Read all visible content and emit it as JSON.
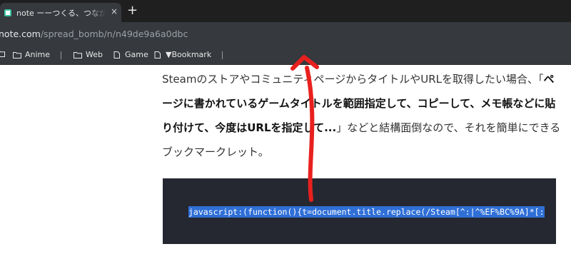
{
  "browser": {
    "tab": {
      "title": "note ーーつくる、つながる、と"
    },
    "new_tab_label": "+",
    "close_label": "×",
    "url": {
      "host": "note.com",
      "path": "/spread_bomb/n/n49de9a6a0dbc"
    },
    "bookmarks": [
      {
        "label": "Anime",
        "icon": "folder-icon"
      },
      {
        "label": "Web",
        "icon": "folder-icon"
      },
      {
        "label": "Game",
        "icon": "file-icon"
      },
      {
        "label": "▼Bookmark",
        "icon": "file-icon"
      }
    ]
  },
  "article": {
    "p1": "Steamのストアやコミュニティページからタイトルや",
    "p2": "URLを取得したい場合、「",
    "bold": "ページに書かれているゲームタイトルを範囲指定して、コピーして、メモ帳などに貼り付けて、今度はURLを指定して...",
    "p3": "」などと結構面倒なので、それを簡単にできるブックマークレット。"
  },
  "code": {
    "text": "javascript:(function(){t=document.title.replace(/Steam[^:|^%EF%BC%9A]*[:"
  },
  "colors": {
    "annotation_arrow": "#e8201e",
    "code_selection": "#2f6fd6",
    "code_background": "#252830"
  }
}
